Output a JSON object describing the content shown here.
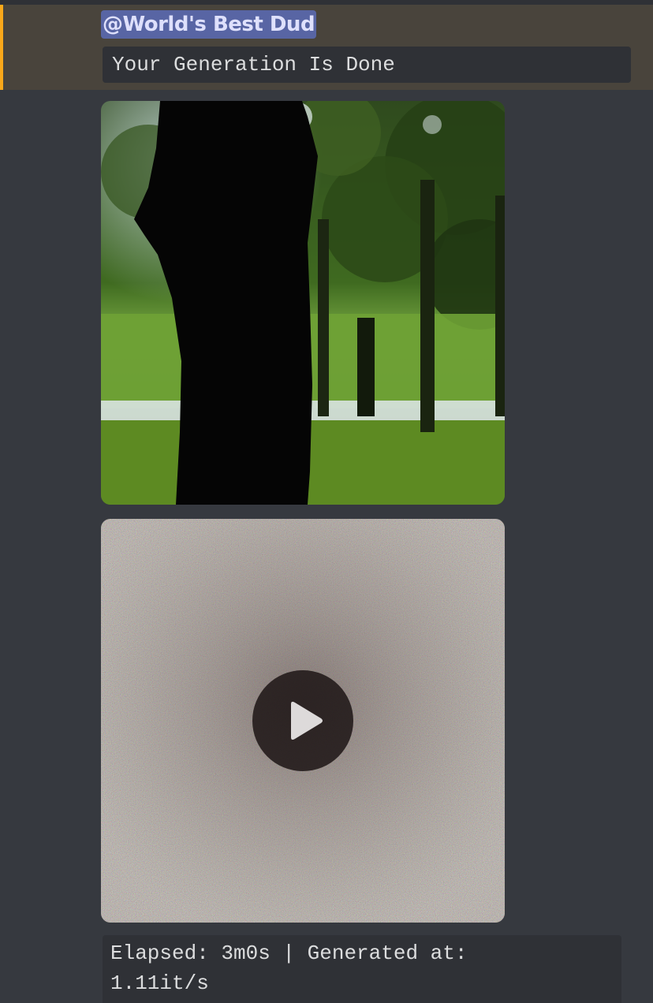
{
  "message": {
    "mention": "@World's Best Dud",
    "status_line": "Your Generation Is Done"
  },
  "attachments": [
    {
      "kind": "image",
      "description_icon": "image-preview"
    },
    {
      "kind": "video",
      "play_icon": "play-icon"
    }
  ],
  "stats": {
    "line1": "Elapsed: 3m0s | Generated at:",
    "line2": "1.11it/s"
  },
  "colors": {
    "background": "#36393f",
    "mention_highlight": "#49443c",
    "mention_bar": "#faa81a",
    "mention_pill": "#5865a4",
    "code_background": "#2f3136"
  }
}
